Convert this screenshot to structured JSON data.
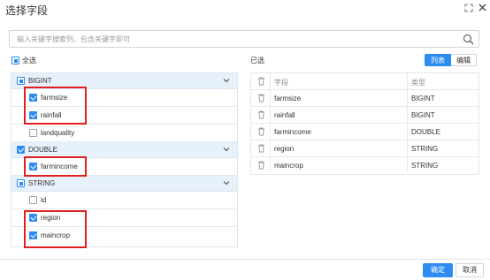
{
  "dialog": {
    "title": "选择字段"
  },
  "search": {
    "placeholder": "输入关键字搜索列，包含关键字即可"
  },
  "select_all": {
    "label": "全选",
    "state": "partial"
  },
  "groups": [
    {
      "name": "BIGINT",
      "state": "partial",
      "items": [
        {
          "label": "farmsize",
          "checked": true
        },
        {
          "label": "rainfall",
          "checked": true
        },
        {
          "label": "landquality",
          "checked": false
        }
      ]
    },
    {
      "name": "DOUBLE",
      "state": "checked",
      "items": [
        {
          "label": "farmincome",
          "checked": true
        }
      ]
    },
    {
      "name": "STRING",
      "state": "partial",
      "items": [
        {
          "label": "id",
          "checked": false
        },
        {
          "label": "region",
          "checked": true
        },
        {
          "label": "maincrop",
          "checked": true
        }
      ]
    }
  ],
  "selected": {
    "label": "已选",
    "view_toggle": {
      "list": "列表",
      "edit": "编辑",
      "active": "list"
    },
    "headers": {
      "field": "字段",
      "type": "类型"
    },
    "rows": [
      {
        "field": "farmsize",
        "type": "BIGINT"
      },
      {
        "field": "rainfall",
        "type": "BIGINT"
      },
      {
        "field": "farmincome",
        "type": "DOUBLE"
      },
      {
        "field": "region",
        "type": "STRING"
      },
      {
        "field": "maincrop",
        "type": "STRING"
      }
    ]
  },
  "footer": {
    "confirm": "确定",
    "cancel": "取消"
  },
  "colors": {
    "accent": "#2d8cf0",
    "highlight": "#e02020",
    "group_bg": "#e7f1fb"
  }
}
